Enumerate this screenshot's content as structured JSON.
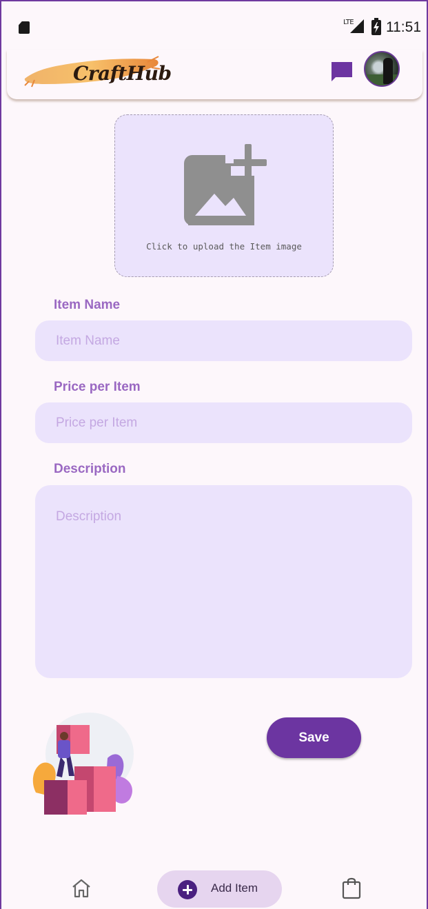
{
  "status_bar": {
    "network": "LTE",
    "time": "11:51",
    "icons": [
      "sd-card-icon",
      "signal-icon",
      "battery-charging-icon"
    ]
  },
  "app_bar": {
    "logo_text": "CraftHub",
    "icons": [
      "chat-icon",
      "avatar"
    ]
  },
  "upload": {
    "text": "Click to upload the Item image",
    "icon": "add-photo-icon"
  },
  "form": {
    "item_name": {
      "label": "Item Name",
      "placeholder": "Item Name",
      "value": ""
    },
    "price": {
      "label": "Price per Item",
      "placeholder": "Price per Item",
      "value": ""
    },
    "description": {
      "label": "Description",
      "placeholder": "Description",
      "value": ""
    }
  },
  "actions": {
    "save_label": "Save"
  },
  "bottom_nav": {
    "items": [
      {
        "icon": "home-icon",
        "label": ""
      },
      {
        "icon": "add-circle-icon",
        "label": "Add Item",
        "selected": true
      },
      {
        "icon": "shopping-bag-icon",
        "label": ""
      }
    ]
  },
  "colors": {
    "accent": "#6c35a1",
    "label": "#9a68c2",
    "field_bg": "#ebe3fc",
    "placeholder": "#c4a8e2",
    "background": "#fdf7fb",
    "nav_selected_bg": "#e6d5ef"
  }
}
